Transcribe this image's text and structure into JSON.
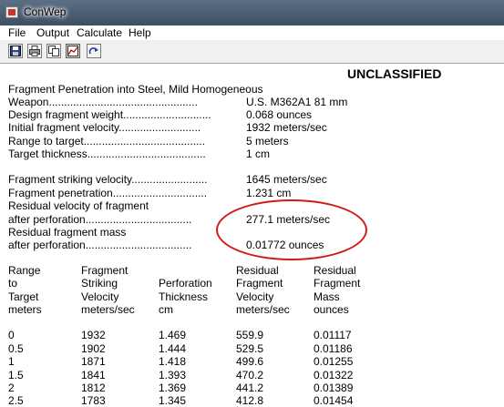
{
  "window": {
    "title": "ConWep"
  },
  "menu": [
    "File",
    "Output",
    "Calculate",
    "Help"
  ],
  "toolbar": {
    "buttons": [
      {
        "icon": "save-icon"
      },
      {
        "icon": "print-icon"
      },
      {
        "icon": "copy-icon"
      },
      {
        "icon": "graph-icon"
      },
      {
        "icon": "redo-icon"
      }
    ]
  },
  "report": {
    "classification": "UNCLASSIFIED",
    "heading": "Fragment Penetration into Steel, Mild Homogeneous",
    "params": [
      {
        "label": "Weapon.................................................",
        "value": "U.S. M362A1 81 mm"
      },
      {
        "label": "Design fragment weight.............................",
        "value": "0.068 ounces"
      },
      {
        "label": "Initial fragment velocity...........................",
        "value": "1932 meters/sec"
      },
      {
        "label": "Range to target........................................",
        "value": "5 meters"
      },
      {
        "label": "Target thickness.......................................",
        "value": "1 cm"
      }
    ],
    "results": [
      {
        "label": "Fragment striking velocity.........................",
        "value": "1645 meters/sec"
      },
      {
        "label": "Fragment penetration...............................",
        "value": "1.231 cm"
      },
      {
        "label": "Residual velocity of fragment",
        "value": ""
      },
      {
        "label": "  after perforation...................................",
        "value": "277.1 meters/sec"
      },
      {
        "label": "Residual fragment mass",
        "value": ""
      },
      {
        "label": "  after perforation...................................",
        "value": "0.01772 ounces"
      }
    ],
    "table": {
      "headers": [
        [
          "Range",
          "to",
          "Target",
          "meters"
        ],
        [
          "Fragment",
          "Striking",
          "Velocity",
          "meters/sec"
        ],
        [
          "",
          "",
          "Perforation",
          "Thickness",
          "cm"
        ],
        [
          "Residual",
          "Fragment",
          "Velocity",
          "meters/sec"
        ],
        [
          "Residual",
          "Fragment",
          "Mass",
          "ounces"
        ]
      ],
      "rows": [
        [
          "0",
          "1932",
          "1.469",
          "559.9",
          "0.01117"
        ],
        [
          "0.5",
          "1902",
          "1.444",
          "529.5",
          "0.01186"
        ],
        [
          "1",
          "1871",
          "1.418",
          "499.6",
          "0.01255"
        ],
        [
          "1.5",
          "1841",
          "1.393",
          "470.2",
          "0.01322"
        ],
        [
          "2",
          "1812",
          "1.369",
          "441.2",
          "0.01389"
        ],
        [
          "2.5",
          "1783",
          "1.345",
          "412.8",
          "0.01454"
        ]
      ]
    }
  },
  "colors": {
    "annotation": "#d11b1b",
    "titlebar": "#4a5c70"
  }
}
